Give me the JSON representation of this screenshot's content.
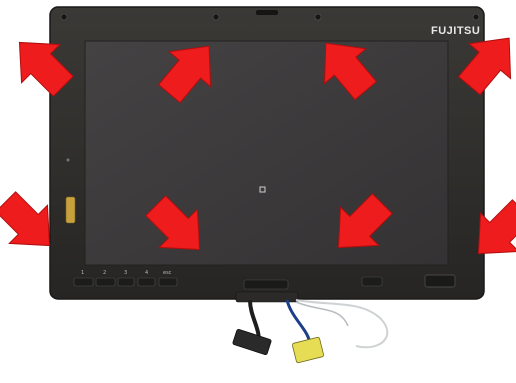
{
  "photo": {
    "brand": "FUJITSU",
    "bezel_color": "#2f2e2b",
    "screen_color": "#3b393a",
    "arrow_color": "#ee1c1c",
    "arrow_count": 8,
    "function_keys": [
      "1",
      "2",
      "3",
      "4",
      "esc"
    ]
  }
}
